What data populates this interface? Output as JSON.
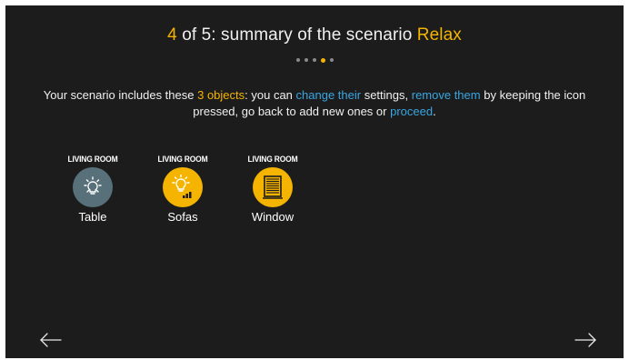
{
  "header": {
    "step_number": "4",
    "step_text": " of 5: summary of the scenario ",
    "scenario_name": "Relax"
  },
  "progress": {
    "total_steps": 5,
    "current_step": 4
  },
  "instructions": {
    "t1": "Your scenario includes these ",
    "objects_count": "3 objects",
    "t2": ":  you can ",
    "change_link": "change their",
    "t3": " settings, ",
    "remove_link": "remove them",
    "t4": " by keeping the icon pressed, go back to add new ones or ",
    "proceed_link": "proceed",
    "t5": "."
  },
  "objects": [
    {
      "room": "LIVING ROOM",
      "name": "Table",
      "icon": "lightbulb-icon",
      "state": "off"
    },
    {
      "room": "LIVING ROOM",
      "name": "Sofas",
      "icon": "dimmer-lightbulb-icon",
      "state": "on"
    },
    {
      "room": "LIVING ROOM",
      "name": "Window",
      "icon": "shutter-icon",
      "state": "on"
    }
  ],
  "navigation": {
    "back_icon": "arrow-left-icon",
    "next_icon": "arrow-right-icon"
  },
  "colors": {
    "background": "#1c1c1c",
    "accent": "#f5b400",
    "link": "#39a6e2",
    "inactive_icon": "#58707a"
  }
}
